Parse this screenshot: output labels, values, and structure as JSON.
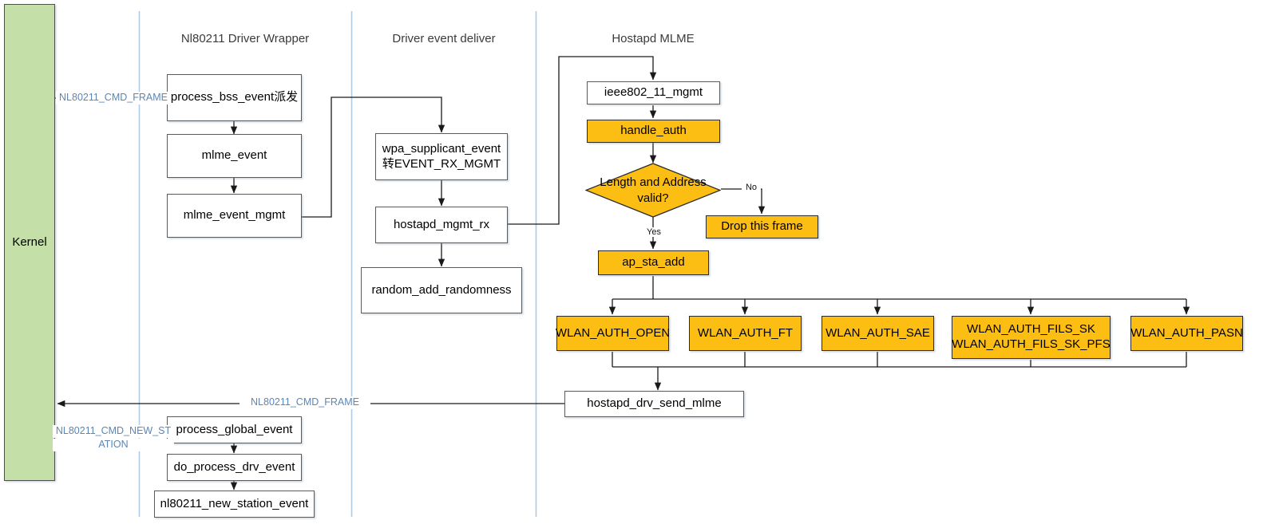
{
  "diagram": {
    "title": "hostapd authentication flow across kernel, driver wrapper and MLME",
    "colors": {
      "orange_fill": "#FDBE14",
      "kernel_fill": "#C5DFA8",
      "plain_fill": "#FFFFFF",
      "lane_divider": "#AFCBE3",
      "edge_label_color": "#5B86B5",
      "border": "#5A5A5A"
    }
  },
  "lanes": [
    {
      "id": "kernel",
      "label": "Kernel"
    },
    {
      "id": "nl80211_driver_wrapper",
      "label": "Nl80211 Driver Wrapper"
    },
    {
      "id": "driver_event_deliver",
      "label": "Driver event deliver"
    },
    {
      "id": "hostapd_mlme",
      "label": "Hostapd MLME"
    }
  ],
  "nodes": {
    "kernel": "Kernel",
    "process_bss_event": "process_bss_event派发",
    "mlme_event": "mlme_event",
    "mlme_event_mgmt": "mlme_event_mgmt",
    "wpa_supplicant_event": "wpa_supplicant_event\n转EVENT_RX_MGMT",
    "wpa_supplicant_event_line1": "wpa_supplicant_event",
    "wpa_supplicant_event_line2": "转EVENT_RX_MGMT",
    "hostapd_mgmt_rx": "hostapd_mgmt_rx",
    "random_add_randomness": "random_add_randomness",
    "ieee802_11_mgmt": "ieee802_11_mgmt",
    "handle_auth": "handle_auth",
    "length_address_valid": "Length and Address valid?",
    "drop_this_frame": "Drop this frame",
    "ap_sta_add": "ap_sta_add",
    "wlan_auth_open": "WLAN_AUTH_OPEN",
    "wlan_auth_ft": "WLAN_AUTH_FT",
    "wlan_auth_sae": "WLAN_AUTH_SAE",
    "wlan_auth_fils_sk": "WLAN_AUTH_FILS_SK",
    "wlan_auth_fils_sk_pfs": "WLAN_AUTH_FILS_SK_PFS",
    "wlan_auth_pasn": "WLAN_AUTH_PASN",
    "hostapd_drv_send_mlme": "hostapd_drv_send_mlme",
    "process_global_event": "process_global_event",
    "do_process_drv_event": "do_process_drv_event",
    "nl80211_new_station_event": "nl80211_new_station_event"
  },
  "edge_labels": {
    "cmd_frame_in": "NL80211_CMD_FRAME",
    "cmd_frame_out": "NL80211_CMD_FRAME",
    "cmd_new_station_line1": "NL80211_CMD_NEW_ST",
    "cmd_new_station_line2": "ATION"
  },
  "decision_labels": {
    "yes": "Yes",
    "no": "No"
  }
}
